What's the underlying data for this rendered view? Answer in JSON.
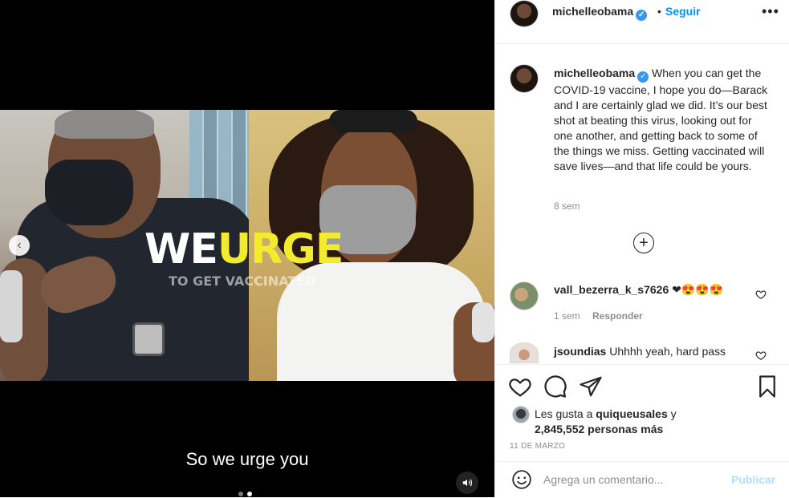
{
  "media": {
    "overlay_word1": "WE",
    "overlay_word2": "URGE",
    "overlay_subtitle": "TO GET VACCINATED",
    "caption": "So we urge you",
    "carousel_total": 2,
    "carousel_active": 2
  },
  "header": {
    "username": "michelleobama",
    "separator": "•",
    "follow_label": "Seguir",
    "more_label": "•••"
  },
  "post": {
    "username": "michelleobama",
    "caption": "When you can get the COVID-19 vaccine, I hope you do—Barack and I are certainly glad we did. It’s our best shot at beating this virus, looking out for one another, and getting back to some of the things we miss. Getting vaccinated will save lives—and that life could be yours.",
    "time": "8 sem"
  },
  "comments": [
    {
      "username": "vall_bezerra_k_s7626",
      "text": "❤😍😍😍",
      "time": "1 sem",
      "reply_label": "Responder"
    },
    {
      "username": "jsoundias",
      "text": "Uhhhh yeah, hard pass"
    }
  ],
  "likes": {
    "prefix": "Les gusta a",
    "user": "quiqueusales",
    "joiner": "y",
    "count_text": "2,845,552 personas más"
  },
  "date": "11 DE MARZO",
  "composer": {
    "placeholder": "Agrega un comentario...",
    "publish_label": "Publicar"
  },
  "colors": {
    "link": "#0095f6",
    "verified": "#3897f0",
    "publish_disabled": "#b2dffc",
    "muted": "#8e8e8e",
    "overlay_yellow": "#f3eb2e"
  }
}
